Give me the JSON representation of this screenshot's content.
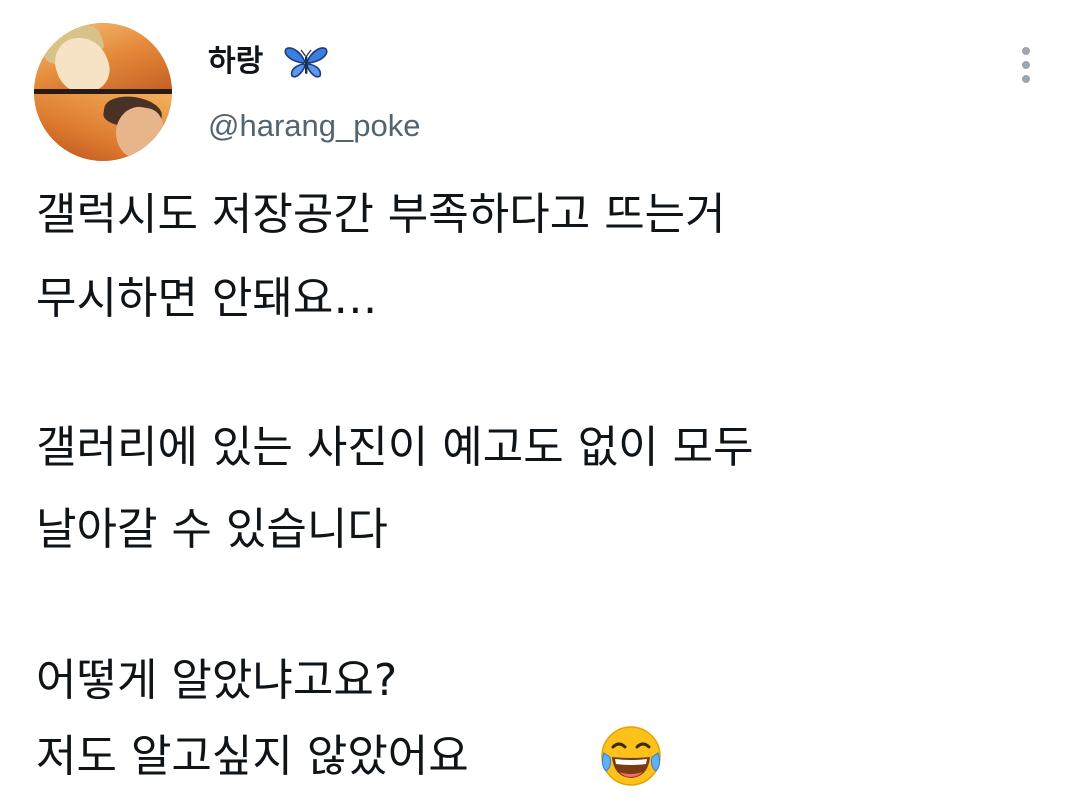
{
  "author": {
    "display_name": "하랑",
    "name_emoji": "butterfly-emoji",
    "handle": "@harang_poke",
    "avatar": "anime-characters-sunset-avatar"
  },
  "menu": {
    "icon": "more-vertical-icon"
  },
  "tweet": {
    "lines": [
      "갤럭시도 저장공간 부족하다고 뜨는거",
      "무시하면 안돼요…",
      "갤러리에 있는 사진이 예고도 없이 모두",
      "날아갈 수 있습니다",
      "어떻게 알았냐고요?",
      "저도 알고싶지 않았어요"
    ],
    "trailing_emoji": "face-with-tears-of-joy-emoji"
  },
  "colors": {
    "text": "#0f1419",
    "secondary": "#536471",
    "butterfly": "#3b7de0"
  }
}
